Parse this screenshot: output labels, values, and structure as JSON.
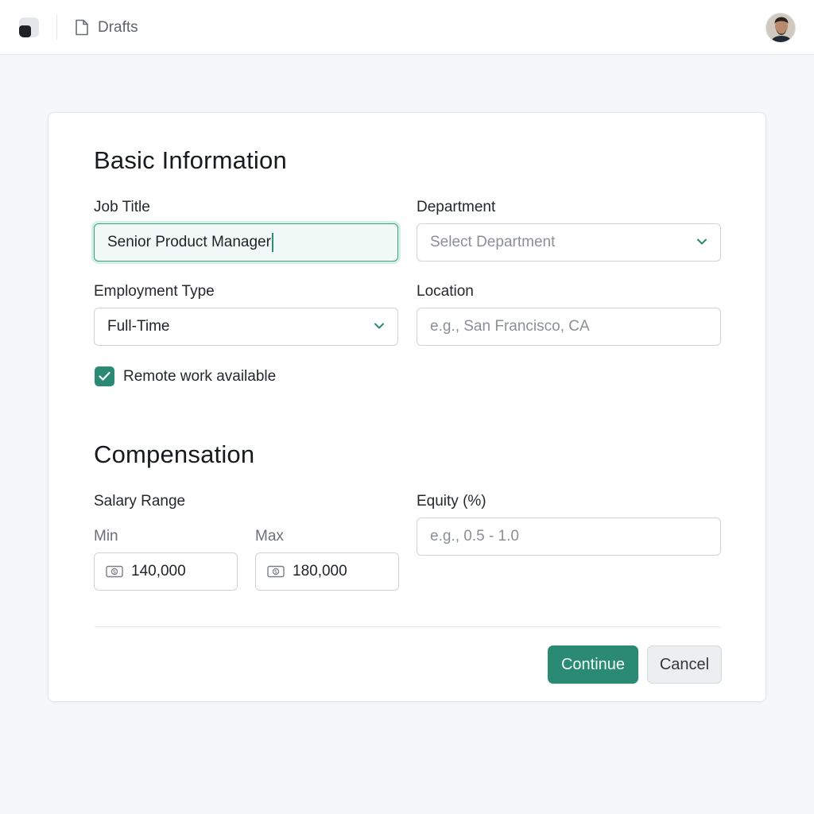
{
  "topbar": {
    "breadcrumb": "Drafts",
    "icons": [
      "app-logo",
      "document-icon",
      "user-avatar"
    ]
  },
  "basic_info": {
    "title": "Basic Information",
    "job_title": {
      "label": "Job Title",
      "value": "Senior Product Manager"
    },
    "department": {
      "label": "Department",
      "placeholder": "Select Department"
    },
    "employment_type": {
      "label": "Employment Type",
      "value": "Full-Time"
    },
    "location": {
      "label": "Location",
      "placeholder": "e.g., San Francisco, CA"
    },
    "remote": {
      "label": "Remote work available",
      "checked": true
    }
  },
  "compensation": {
    "title": "Compensation",
    "salary_range_label": "Salary Range",
    "min": {
      "label": "Min",
      "value": "140,000"
    },
    "max": {
      "label": "Max",
      "value": "180,000"
    },
    "equity": {
      "label": "Equity (%)",
      "placeholder": "e.g., 0.5 - 1.0"
    }
  },
  "actions": {
    "continue_label": "Continue",
    "cancel_label": "Cancel"
  },
  "colors": {
    "accent": "#2a8a74",
    "focus_bg": "#f1f9f6",
    "page_bg": "#f6f7f8"
  }
}
